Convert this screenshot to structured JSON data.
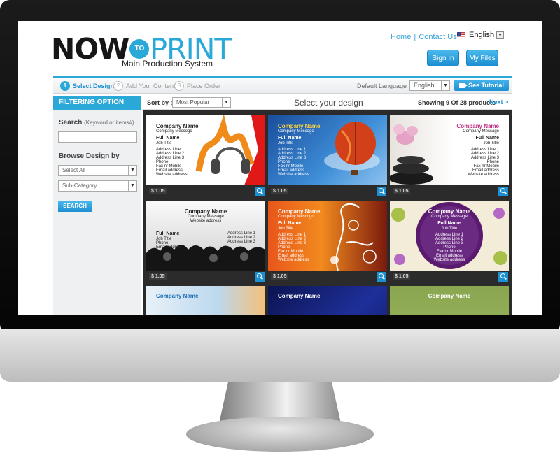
{
  "header": {
    "logo": {
      "now": "NOW",
      "to": "TO",
      "print": "PRINT",
      "subtitle": "Main Production System"
    },
    "links": {
      "home": "Home",
      "sep": "|",
      "contact": "Contact Us"
    },
    "language": {
      "label": "English",
      "flag_icon": "us-flag-icon"
    },
    "buttons": {
      "sign_in": "Sign In",
      "my_files": "My Files"
    }
  },
  "steps": [
    {
      "num": "1",
      "label": "Select Design",
      "active": true
    },
    {
      "num": "2",
      "label": "Add Your Content",
      "active": false
    },
    {
      "num": "3",
      "label": "Place Order",
      "active": false
    }
  ],
  "stepbar": {
    "default_language_label": "Default Language",
    "language_value": "English",
    "tutorial_button": "See Tutorial"
  },
  "sidebar": {
    "title": "FILTERING OPTION",
    "search_label": "Search",
    "search_hint": "(Keyword or items#)",
    "search_value": "",
    "browse_label": "Browse Design by",
    "select_all": "Select All",
    "sub_category": "Sub-Category",
    "search_button": "SEARCH"
  },
  "main": {
    "sort_label": "Sort by :",
    "sort_value": "Most Popular",
    "title": "Select your design",
    "showing": "Showing 9 Of 28 products",
    "next": "Next >"
  },
  "cards": [
    {
      "price": "$ 1.05",
      "company": "Company Name",
      "slogan": "Company Mescogo",
      "name": "Full Name",
      "title": "Job Title",
      "lines": [
        "Address Line 1",
        "Address Line 2",
        "Address Line 3",
        "Phone",
        "Fax nr Mobile",
        "Email address",
        "Website address"
      ]
    },
    {
      "price": "$ 1.05",
      "company": "Company Name",
      "slogan": "Company Mescogo",
      "name": "Full Name",
      "title": "Job Title",
      "lines": [
        "Address Line 1",
        "Address Line 2",
        "Address Line 3",
        "Phone",
        "Fax nr Mobile",
        "Email address",
        "Website address"
      ]
    },
    {
      "price": "$ 1.05",
      "company": "Company Name",
      "slogan": "Company Message",
      "name": "Full Name",
      "title": "Job Title",
      "lines": [
        "Address Line 1",
        "Address Line 2",
        "Address Line 3",
        "Phone",
        "Fax nr Mobile",
        "Email address",
        "Website address"
      ]
    },
    {
      "price": "$ 1.05",
      "company": "Company Name",
      "slogan": "Company Message",
      "name": "Full Name",
      "title": "Job Title",
      "website": "Website address",
      "lines": [
        "Address Line 1",
        "Address Line 2",
        "Address Line 3"
      ],
      "lines_left": [
        "Phone",
        "Email address"
      ]
    },
    {
      "price": "$ 1.05",
      "company": "Company Name",
      "slogan": "Company Mescogo",
      "name": "Full Name",
      "title": "Job Title",
      "lines": [
        "Address Line 1",
        "Address Line 2",
        "Address Line 3",
        "Phone",
        "Fax nr Mobile",
        "Email address",
        "Website address"
      ]
    },
    {
      "price": "$ 1.05",
      "company": "Company Name",
      "slogan": "Company Message",
      "name": "Full Name",
      "title": "Job Title",
      "lines": [
        "Address Line 1",
        "Address Line 2",
        "Address Line 3",
        "Phone",
        "Fax nr Mobile",
        "Email address",
        "Website address"
      ]
    },
    {
      "company": "Company Name"
    },
    {
      "company": "Company Name"
    },
    {
      "company": "Company Name"
    }
  ]
}
